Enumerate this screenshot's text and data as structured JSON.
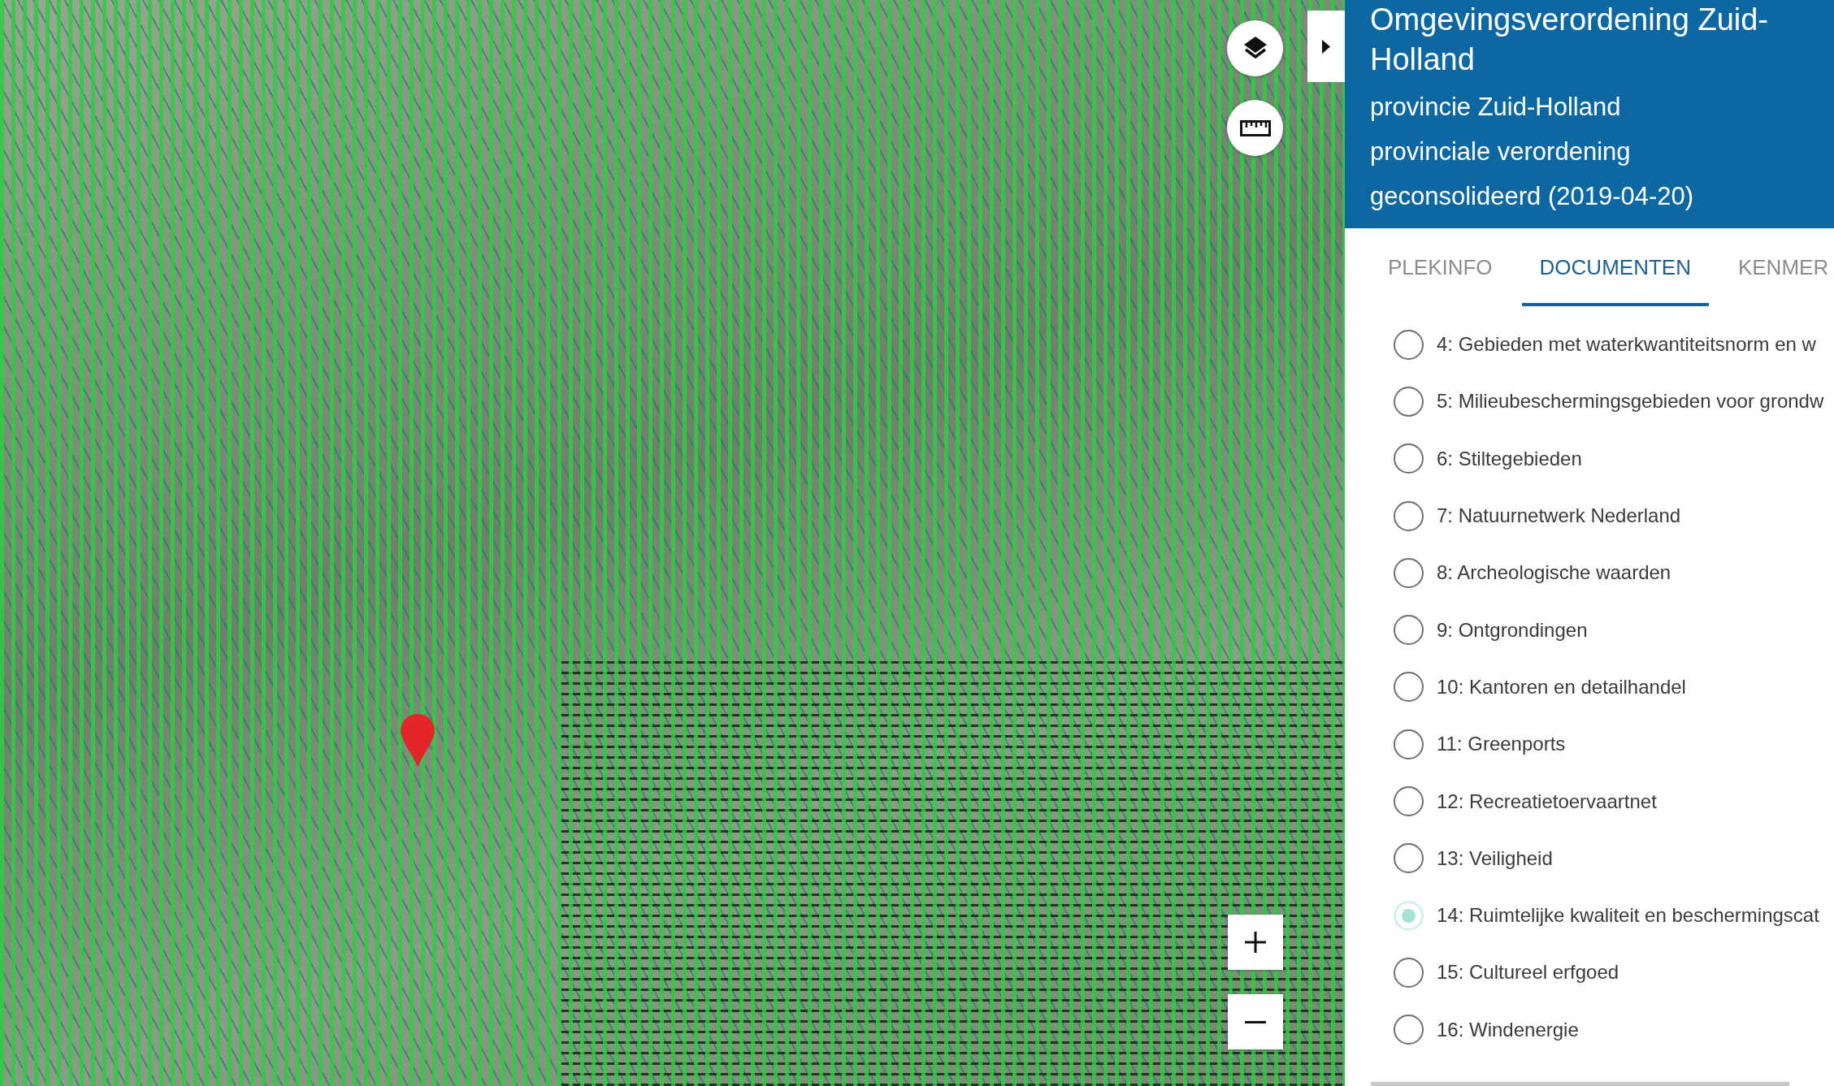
{
  "panel": {
    "title": "Omgevingsverordening Zuid-Holland",
    "subtitles": [
      "provincie Zuid-Holland",
      "provinciale verordening",
      "geconsolideerd (2019-04-20)"
    ]
  },
  "tabs": [
    {
      "label": "PLEKINFO",
      "selected": false
    },
    {
      "label": "DOCUMENTEN",
      "selected": true
    },
    {
      "label": "KENMER",
      "selected": false
    }
  ],
  "documents": [
    {
      "label": "4: Gebieden met waterkwantiteitsnorm en w",
      "selected": false
    },
    {
      "label": "5: Milieubeschermingsgebieden voor grondw",
      "selected": false
    },
    {
      "label": "6: Stiltegebieden",
      "selected": false
    },
    {
      "label": "7: Natuurnetwerk Nederland",
      "selected": false
    },
    {
      "label": "8: Archeologische waarden",
      "selected": false
    },
    {
      "label": "9: Ontgrondingen",
      "selected": false
    },
    {
      "label": "10: Kantoren en detailhandel",
      "selected": false
    },
    {
      "label": "11: Greenports",
      "selected": false
    },
    {
      "label": "12: Recreatietoervaartnet",
      "selected": false
    },
    {
      "label": "13: Veiligheid",
      "selected": false
    },
    {
      "label": "14: Ruimtelijke kwaliteit en beschermingscat",
      "selected": true
    },
    {
      "label": "15: Cultureel erfgoed",
      "selected": false
    },
    {
      "label": "16: Windenergie",
      "selected": false
    }
  ]
}
